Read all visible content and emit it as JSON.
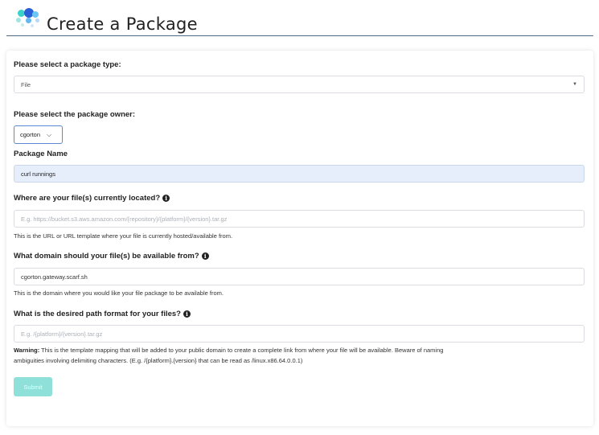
{
  "header": {
    "title": "Create a Package"
  },
  "form": {
    "package_type": {
      "label": "Please select a package type:",
      "value": "File"
    },
    "owner": {
      "label": "Please select the package owner:",
      "value": "cgorton"
    },
    "package_name": {
      "label": "Package Name",
      "value": "curl runnings"
    },
    "file_location": {
      "label": "Where are your file(s) currently located?",
      "placeholder": "E.g. https://bucket.s3.aws.amazon.com/{repository}/{platform}/{version}.tar.gz",
      "help": "This is the URL or URL template where your file is currently hosted/available from."
    },
    "domain": {
      "label": "What domain should your file(s) be available from?",
      "value": "cgorton.gateway.scarf.sh",
      "help": "This is the domain where you would like your file package to be available from."
    },
    "path_format": {
      "label": "What is the desired path format for your files?",
      "placeholder": "E.g. /{platform}/{version}.tar.gz",
      "warning_label": "Warning:",
      "warning_line1": "This is the template mapping that will be added to your public domain to create a complete link from where your file will be available.  Beware of naming",
      "warning_line2": "ambiguities involving delimiting characters. (E.g. /{platform}.{version} that can be read as /linux.x86.64.0.0.1)"
    },
    "submit_label": "Submit"
  },
  "colors": {
    "accent_border": "#5b8ad6",
    "name_field_bg": "#e5eefa",
    "submit_bg": "#8ee0d8",
    "header_rule": "#4f6b86"
  }
}
